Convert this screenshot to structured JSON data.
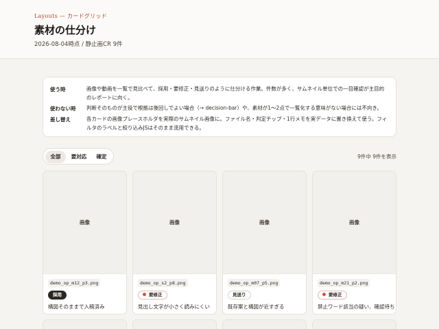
{
  "header": {
    "eyebrow": "Layouts — カードグリッド",
    "title": "素材の仕分け",
    "meta": "2026-08-04時点 / 静止画CR 9件"
  },
  "info": {
    "rows": [
      {
        "key": "使う時",
        "value": "画像や動画を一覧で見比べて、採用・要修正・見送りのように仕分ける作業。件数が多く、サムネイル単位での一目確認が主目的のレポートに向く。"
      },
      {
        "key": "使わない時",
        "value": "判断そのものが主役で根拠は後回しでよい場合（→ decision-bar）や、素材が1〜2点で一覧化する意味がない場合には不向き。"
      },
      {
        "key": "差し替え",
        "value": "各カードの画像プレースホルダを実際のサムネイル画像に。ファイル名・判定チップ・1行メモを実データに置き換えて使う。フィルタのラベルと絞り込みJSはそのまま流用できる。"
      }
    ]
  },
  "filters": {
    "items": [
      {
        "label": "全部",
        "active": true
      },
      {
        "label": "要対応",
        "active": false
      },
      {
        "label": "確定",
        "active": false
      }
    ]
  },
  "count_label": "9件中 9件を表示",
  "cards": [
    {
      "thumb_label": "画像",
      "filename": "demo_op_m12_p3.png",
      "status": "採用",
      "status_type": "ok",
      "note": "構図そのままで入稿済み"
    },
    {
      "thumb_label": "画像",
      "filename": "demo_op_s2_p8.png",
      "status": "要修正",
      "status_type": "fix",
      "note": "見出し文字が小さく読みにくい"
    },
    {
      "thumb_label": "画像",
      "filename": "demo_op_m07_p5.png",
      "status": "見送り",
      "status_type": "hold",
      "note": "既存案と構図が近すぎる"
    },
    {
      "thumb_label": "画像",
      "filename": "demo_op_m21_p2.png",
      "status": "要修正",
      "status_type": "fix",
      "note": "禁止ワード該当の疑い、確認待ち"
    }
  ]
}
